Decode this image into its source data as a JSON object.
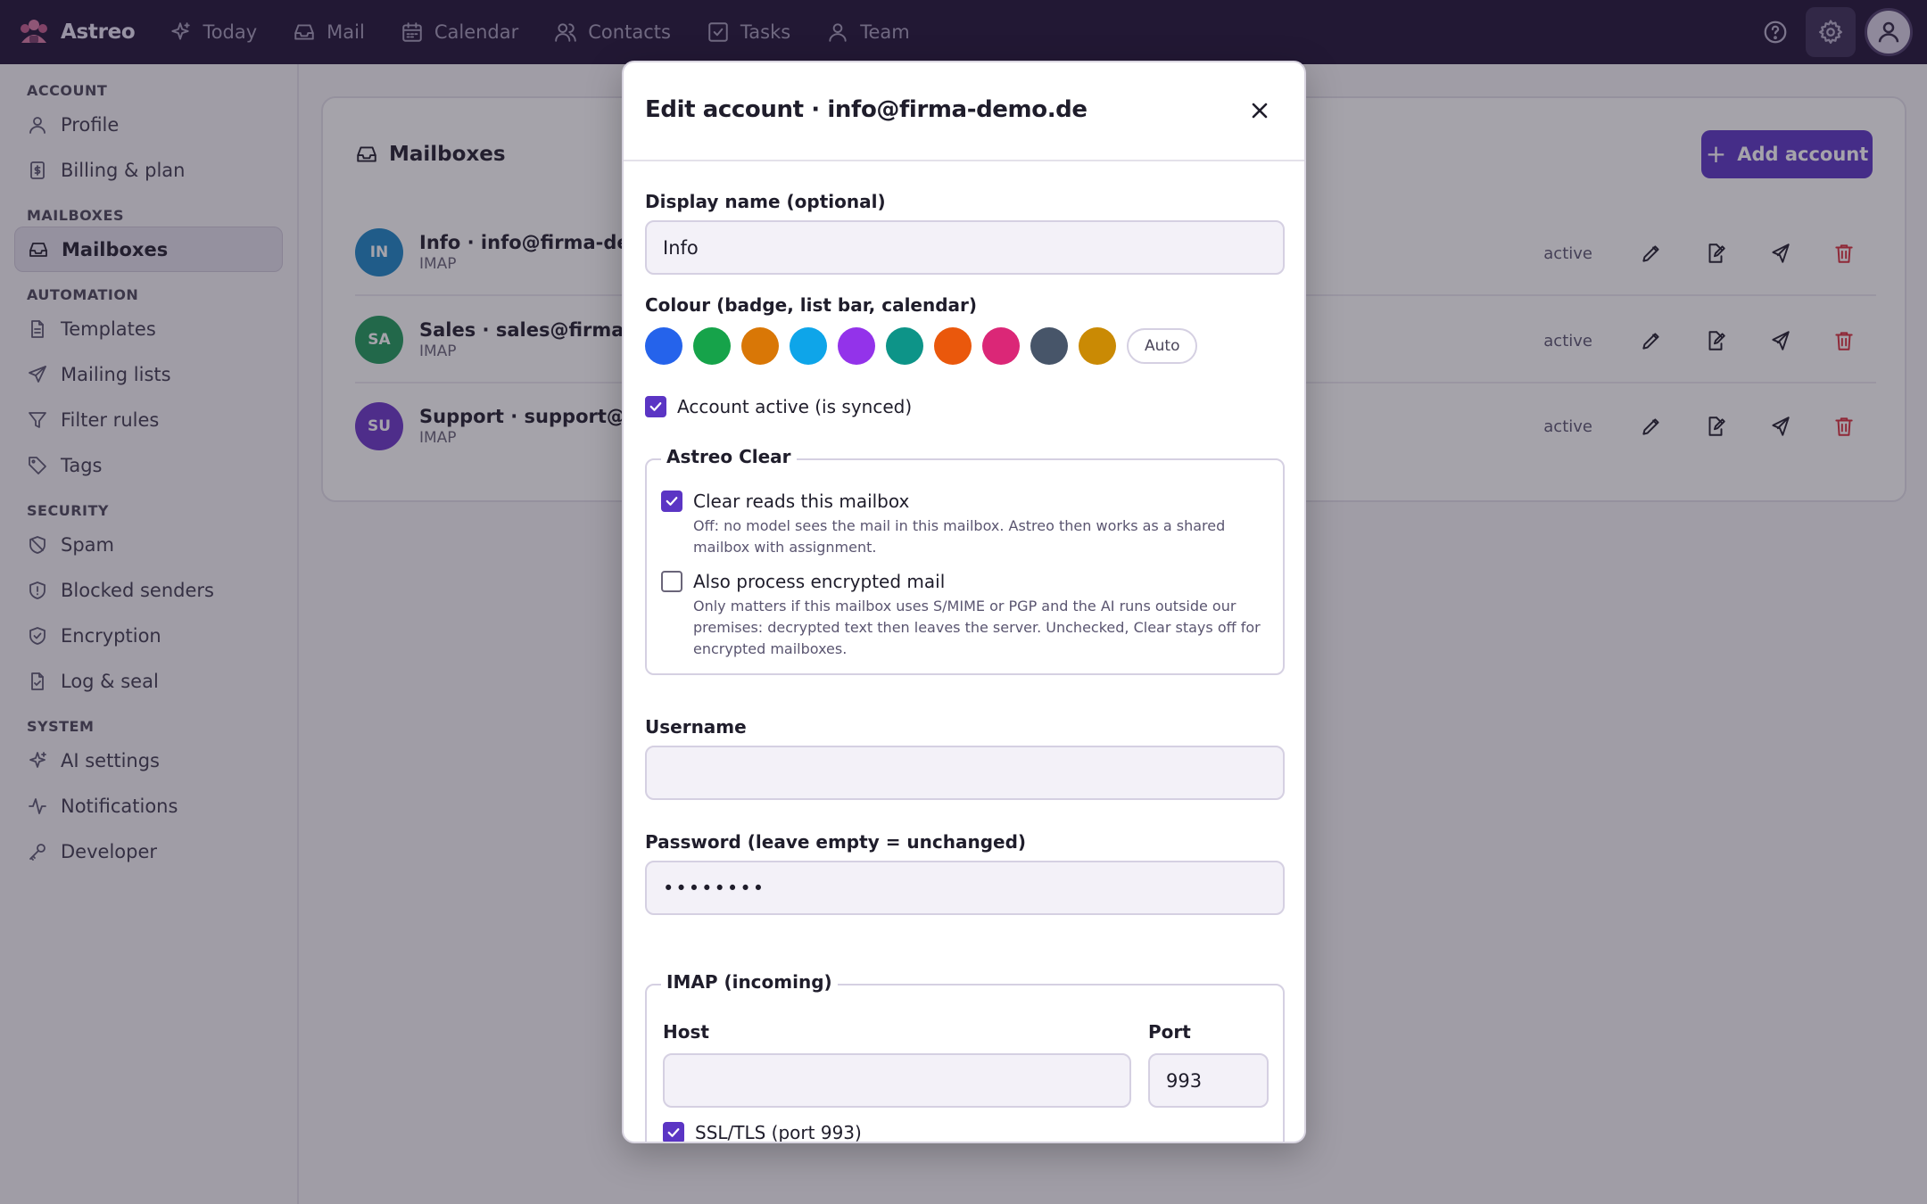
{
  "app": {
    "name": "Astreo"
  },
  "topnav": [
    {
      "label": "Today",
      "icon": "sparkle-icon"
    },
    {
      "label": "Mail",
      "icon": "inbox-icon"
    },
    {
      "label": "Calendar",
      "icon": "calendar-icon"
    },
    {
      "label": "Contacts",
      "icon": "users-icon"
    },
    {
      "label": "Tasks",
      "icon": "check-square-icon"
    },
    {
      "label": "Team",
      "icon": "team-icon"
    }
  ],
  "sidebar": {
    "groups": [
      {
        "heading": "ACCOUNT",
        "items": [
          {
            "label": "Profile"
          },
          {
            "label": "Billing & plan"
          }
        ]
      },
      {
        "heading": "MAILBOXES",
        "items": [
          {
            "label": "Mailboxes",
            "active": true
          }
        ]
      },
      {
        "heading": "AUTOMATION",
        "items": [
          {
            "label": "Templates"
          },
          {
            "label": "Mailing lists"
          },
          {
            "label": "Filter rules"
          },
          {
            "label": "Tags"
          }
        ]
      },
      {
        "heading": "SECURITY",
        "items": [
          {
            "label": "Spam"
          },
          {
            "label": "Blocked senders"
          },
          {
            "label": "Encryption"
          },
          {
            "label": "Log & seal"
          }
        ]
      },
      {
        "heading": "SYSTEM",
        "items": [
          {
            "label": "AI settings"
          },
          {
            "label": "Notifications"
          },
          {
            "label": "Developer"
          }
        ]
      }
    ]
  },
  "main": {
    "title": "Mailboxes",
    "add_button": "Add account",
    "mailboxes": [
      {
        "initials": "IN",
        "name": "Info · info@firma-demo",
        "protocol": "IMAP",
        "status": "active",
        "color": "#1a86c7"
      },
      {
        "initials": "SA",
        "name": "Sales · sales@firma-der",
        "protocol": "IMAP",
        "status": "active",
        "color": "#1e9a5a"
      },
      {
        "initials": "SU",
        "name": "Support · support@firm",
        "protocol": "IMAP",
        "status": "active",
        "color": "#6a35c9"
      }
    ]
  },
  "modal": {
    "title": "Edit account · info@firma-demo.de",
    "display_name_label": "Display name (optional)",
    "display_name_value": "Info",
    "colour_label": "Colour (badge, list bar, calendar)",
    "colours": [
      "#2563eb",
      "#16a34a",
      "#d97706",
      "#0ea5e9",
      "#9333ea",
      "#0d9488",
      "#ea580c",
      "#db2777",
      "#475569",
      "#ca8a04"
    ],
    "auto_label": "Auto",
    "active_label": "Account active (is synced)",
    "active_checked": true,
    "clear_legend": "Astreo Clear",
    "clear_reads_label": "Clear reads this mailbox",
    "clear_reads_desc": "Off: no model sees the mail in this mailbox. Astreo then works as a shared mailbox with assignment.",
    "clear_reads_checked": true,
    "encrypted_label": "Also process encrypted mail",
    "encrypted_desc": "Only matters if this mailbox uses S/MIME or PGP and the AI runs outside our premises: decrypted text then leaves the server. Unchecked, Clear stays off for encrypted mailboxes.",
    "encrypted_checked": false,
    "username_label": "Username",
    "username_value": "",
    "password_label": "Password (leave empty = unchanged)",
    "password_value": "••••••••",
    "imap_legend": "IMAP (incoming)",
    "host_label": "Host",
    "host_value": "",
    "port_label": "Port",
    "port_value": "993",
    "ssl_label": "SSL/TLS (port 993)",
    "ssl_checked": true
  }
}
